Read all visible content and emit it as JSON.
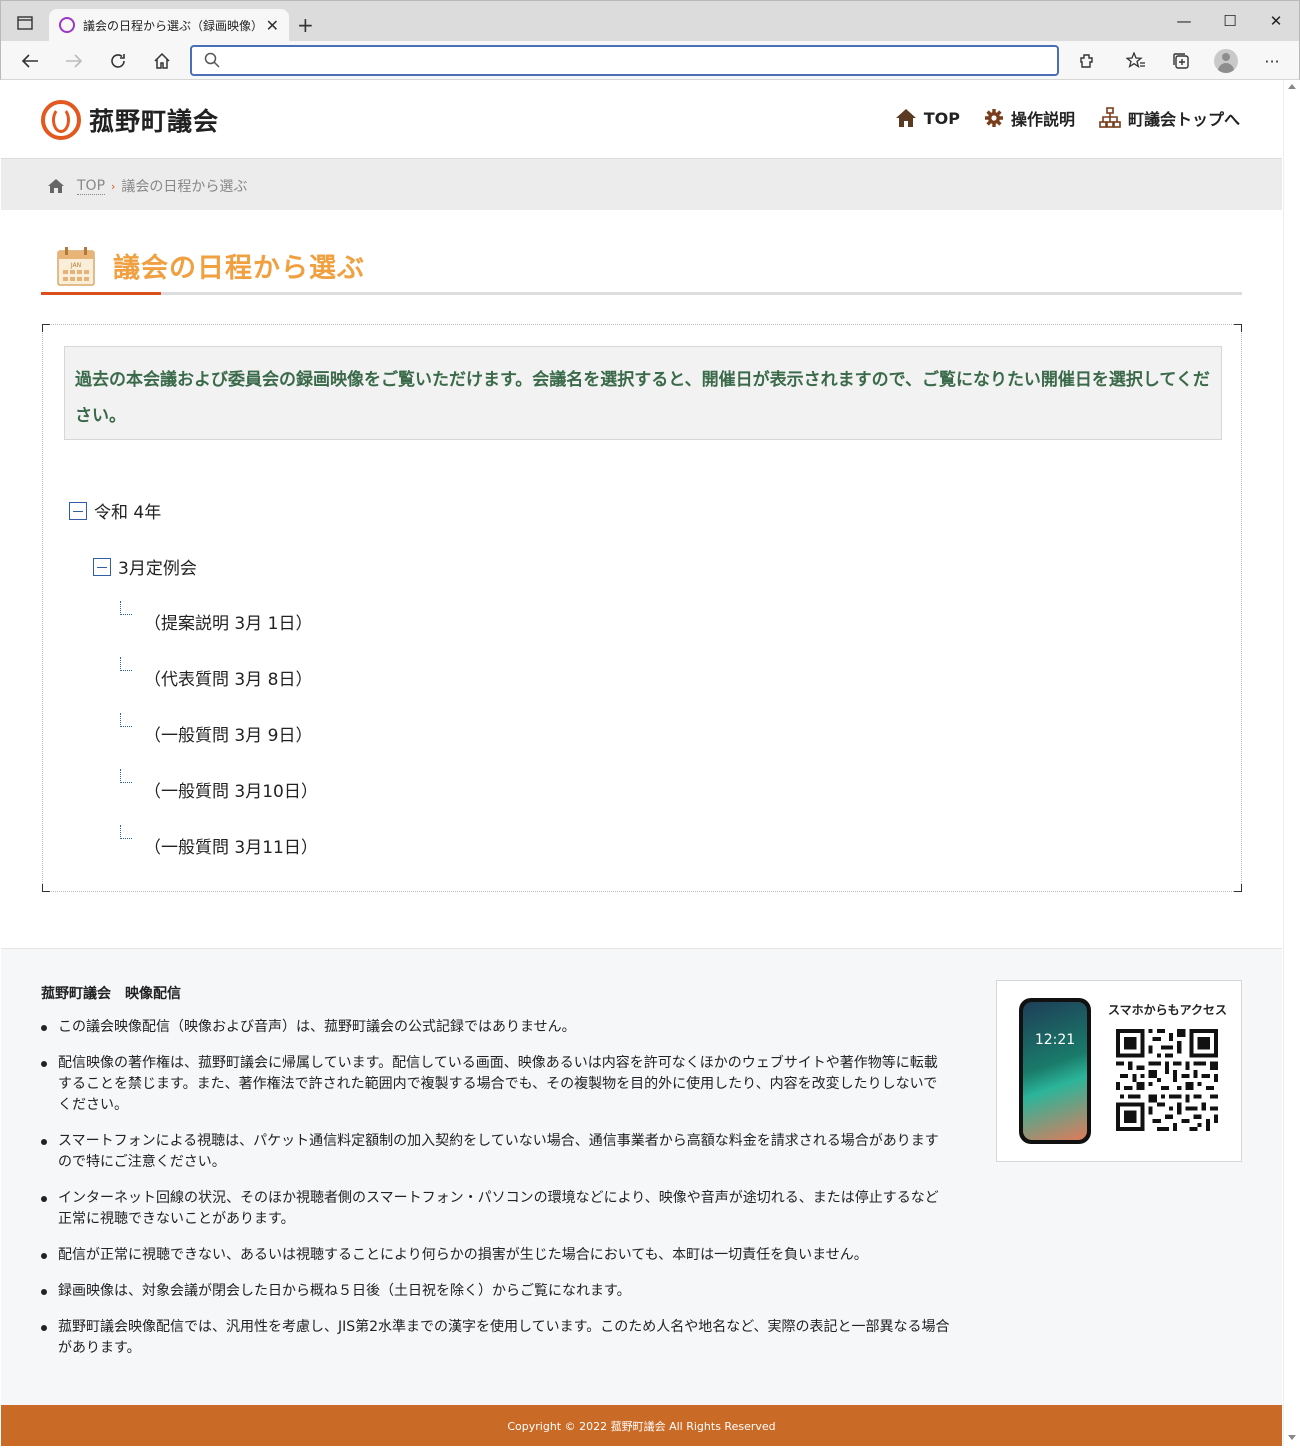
{
  "browser": {
    "tab_title": "議会の日程から選ぶ（録画映像）",
    "address": ""
  },
  "header": {
    "logo_text": "菰野町議会",
    "nav": [
      {
        "label": "TOP",
        "icon": "home-icon"
      },
      {
        "label": "操作説明",
        "icon": "gear-icon"
      },
      {
        "label": "町議会トップへ",
        "icon": "sitemap-icon"
      }
    ]
  },
  "breadcrumb": {
    "top": "TOP",
    "separator": "›",
    "current": "議会の日程から選ぶ"
  },
  "page": {
    "title": "議会の日程から選ぶ",
    "calendar_badge": "JAN",
    "notice": "過去の本会議および委員会の録画映像をご覧いただけます。会議名を選択すると、開催日が表示されますので、ご覧になりたい開催日を選択してください。"
  },
  "tree": {
    "year": "令和 4年",
    "session": "3月定例会",
    "days": [
      "（提案説明 3月 1日）",
      "（代表質問 3月 8日）",
      "（一般質問 3月 9日）",
      "（一般質問 3月10日）",
      "（一般質問 3月11日）"
    ]
  },
  "footer": {
    "title": "菰野町議会　映像配信",
    "items": [
      "この議会映像配信（映像および音声）は、菰野町議会の公式記録ではありません。",
      "配信映像の著作権は、菰野町議会に帰属しています。配信している画面、映像あるいは内容を許可なくほかのウェブサイトや著作物等に転載することを禁じます。また、著作権法で許された範囲内で複製する場合でも、その複製物を目的外に使用したり、内容を改変したりしないでください。",
      "スマートフォンによる視聴は、パケット通信料定額制の加入契約をしていない場合、通信事業者から高額な料金を請求される場合がありますので特にご注意ください。",
      "インターネット回線の状況、そのほか視聴者側のスマートフォン・パソコンの環境などにより、映像や音声が途切れる、または停止するなど正常に視聴できないことがあります。",
      "配信が正常に視聴できない、あるいは視聴することにより何らかの損害が生じた場合においても、本町は一切責任を負いません。",
      "録画映像は、対象会議が閉会した日から概ね５日後（土日祝を除く）からご覧になれます。",
      "菰野町議会映像配信では、汎用性を考慮し、JIS第2水準までの漢字を使用しています。このため人名や地名など、実際の表記と一部異なる場合があります。"
    ],
    "qr_label": "スマホからもアクセス",
    "phone_time": "12:21",
    "copyright": "Copyright © 2022 菰野町議会 All Rights Reserved"
  },
  "colors": {
    "accent_orange": "#e2581e",
    "title_orange": "#f0a040",
    "notice_green": "#3a6a4a",
    "footer_bar": "#c96a26"
  }
}
